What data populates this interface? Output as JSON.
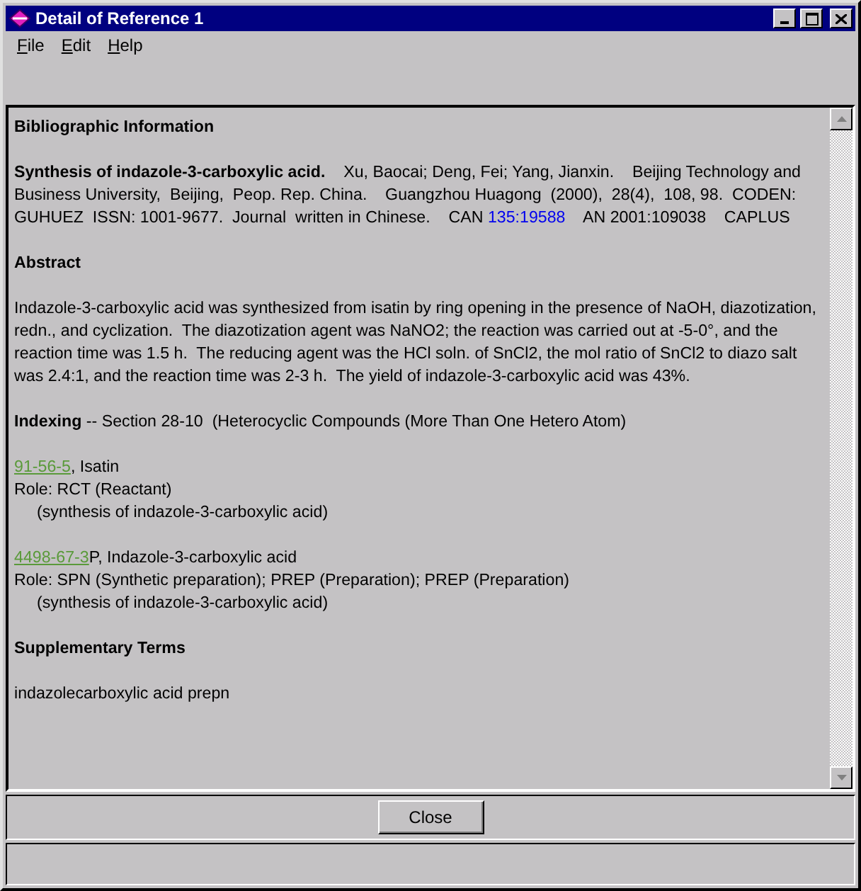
{
  "window": {
    "title": "Detail of Reference 1"
  },
  "menu": [
    {
      "label": "File"
    },
    {
      "label": "Edit"
    },
    {
      "label": "Help"
    }
  ],
  "content": [
    {
      "kind": "heading",
      "text": "Bibliographic Information"
    },
    {
      "kind": "citation",
      "text": "**Synthesis of indazole-3-carboxylic acid.**    Xu, Baocai; Deng, Fei; Yang, Jianxin.    Beijing Technology and Business University,  Beijing,  Peop. Rep. China.    Guangzhou Huagong  (2000),  28(4),  108, 98.  CODEN: GUHUEZ  ISSN: 1001-9677.  Journal  written in Chinese.    CAN ",
      "link": "135:19588",
      "tail": "    AN 2001:109038    CAPLUS"
    },
    {
      "kind": "heading",
      "text": "Abstract"
    },
    {
      "kind": "paragraph",
      "text": "Indazole-3-carboxylic acid was synthesized from isatin by ring opening in the presence of NaOH, diazotization, redn., and cyclization.  The diazotization agent was NaNO2; the reaction was carried out at -5-0°, and the reaction time was 1.5 h.  The reducing agent was the HCl soln. of SnCl2, the mol ratio of SnCl2 to diazo salt was 2.4:1, and the reaction time was 2-3 h.  The yield of indazole-3-carboxylic acid was 43%."
    },
    {
      "kind": "paragraph",
      "text": "**Indexing** -- Section 28-10  (Heterocyclic Compounds (More Than One Hetero Atom)"
    },
    {
      "kind": "substance",
      "link": "91-56-5",
      "name": ", Isatin",
      "role": "Role: RCT (Reactant)",
      "note": "(synthesis of indazole-3-carboxylic acid)"
    },
    {
      "kind": "substance",
      "link": "4498-67-3",
      "name": "P, Indazole-3-carboxylic acid",
      "role": "Role: SPN (Synthetic preparation); PREP (Preparation); PREP (Preparation)",
      "note": "(synthesis of indazole-3-carboxylic acid)"
    },
    {
      "kind": "heading",
      "text": "Supplementary Terms"
    },
    {
      "kind": "paragraph",
      "text": "indazolecarboxylic acid prepn"
    }
  ],
  "buttons": [
    {
      "label": "Close"
    }
  ]
}
